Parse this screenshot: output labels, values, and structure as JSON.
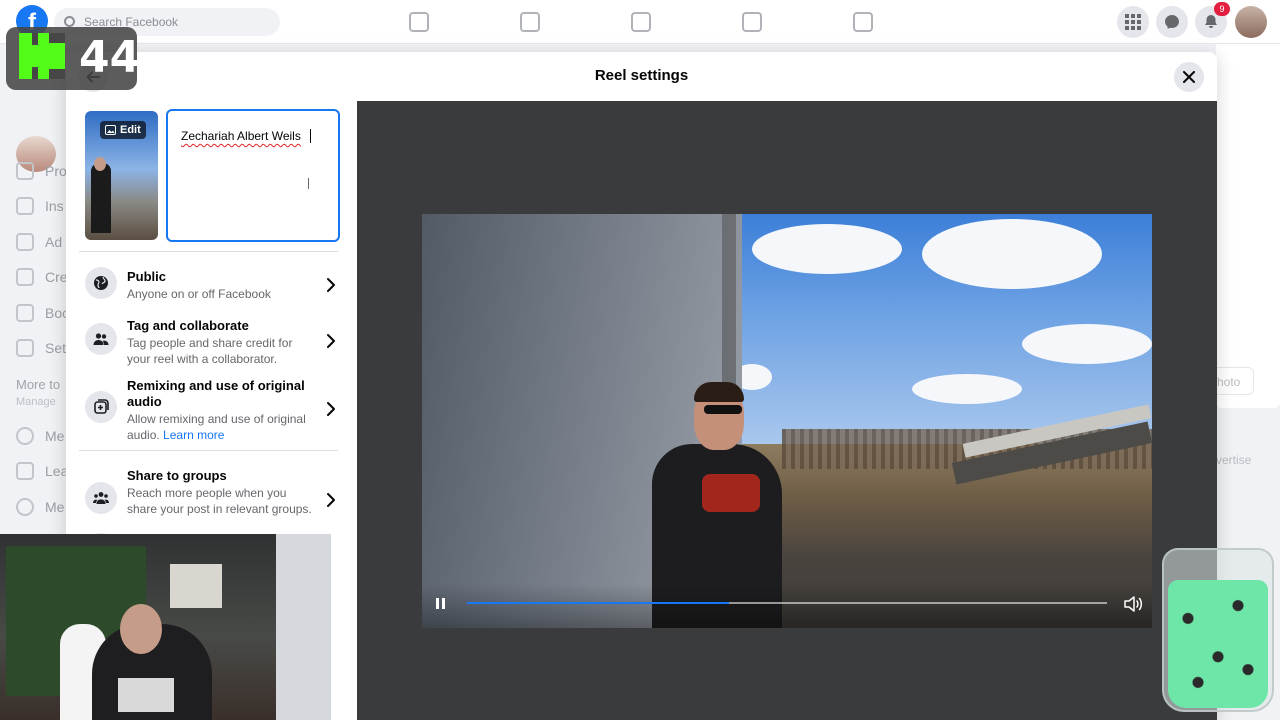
{
  "background": {
    "search_placeholder": "Search Facebook",
    "notification_count": "9",
    "left_nav": [
      "Pro",
      "Ins",
      "Ad",
      "Cre",
      "Boo",
      "Set"
    ],
    "left_nav_heading": "More to",
    "left_nav_sub": "Manage",
    "left_nav_more": [
      "Me",
      "Lea",
      "Me"
    ],
    "right_ghost_button": "hoto",
    "right_ghost_link": "vertise"
  },
  "overlay": {
    "kick_count": "44"
  },
  "modal": {
    "title": "Reel settings",
    "edit_label": "Edit",
    "caption": "Zechariah Albert Weils",
    "options": [
      {
        "title": "Public",
        "desc": "Anyone on or off Facebook",
        "icon": "globe-icon"
      },
      {
        "title": "Tag and collaborate",
        "desc": "Tag people and share credit for your reel with a collaborator.",
        "icon": "people-icon"
      },
      {
        "title": "Remixing and use of original audio",
        "desc": "Allow remixing and use of original audio.",
        "link": "Learn more",
        "icon": "remix-icon"
      },
      {
        "title": "Share to groups",
        "desc": "Reach more people when you share your post in relevant groups.",
        "icon": "groups-icon"
      }
    ],
    "video": {
      "progress": 0.41,
      "playing": true
    }
  },
  "colors": {
    "accent": "#1877f2",
    "video_bg": "#3a3b3c"
  }
}
